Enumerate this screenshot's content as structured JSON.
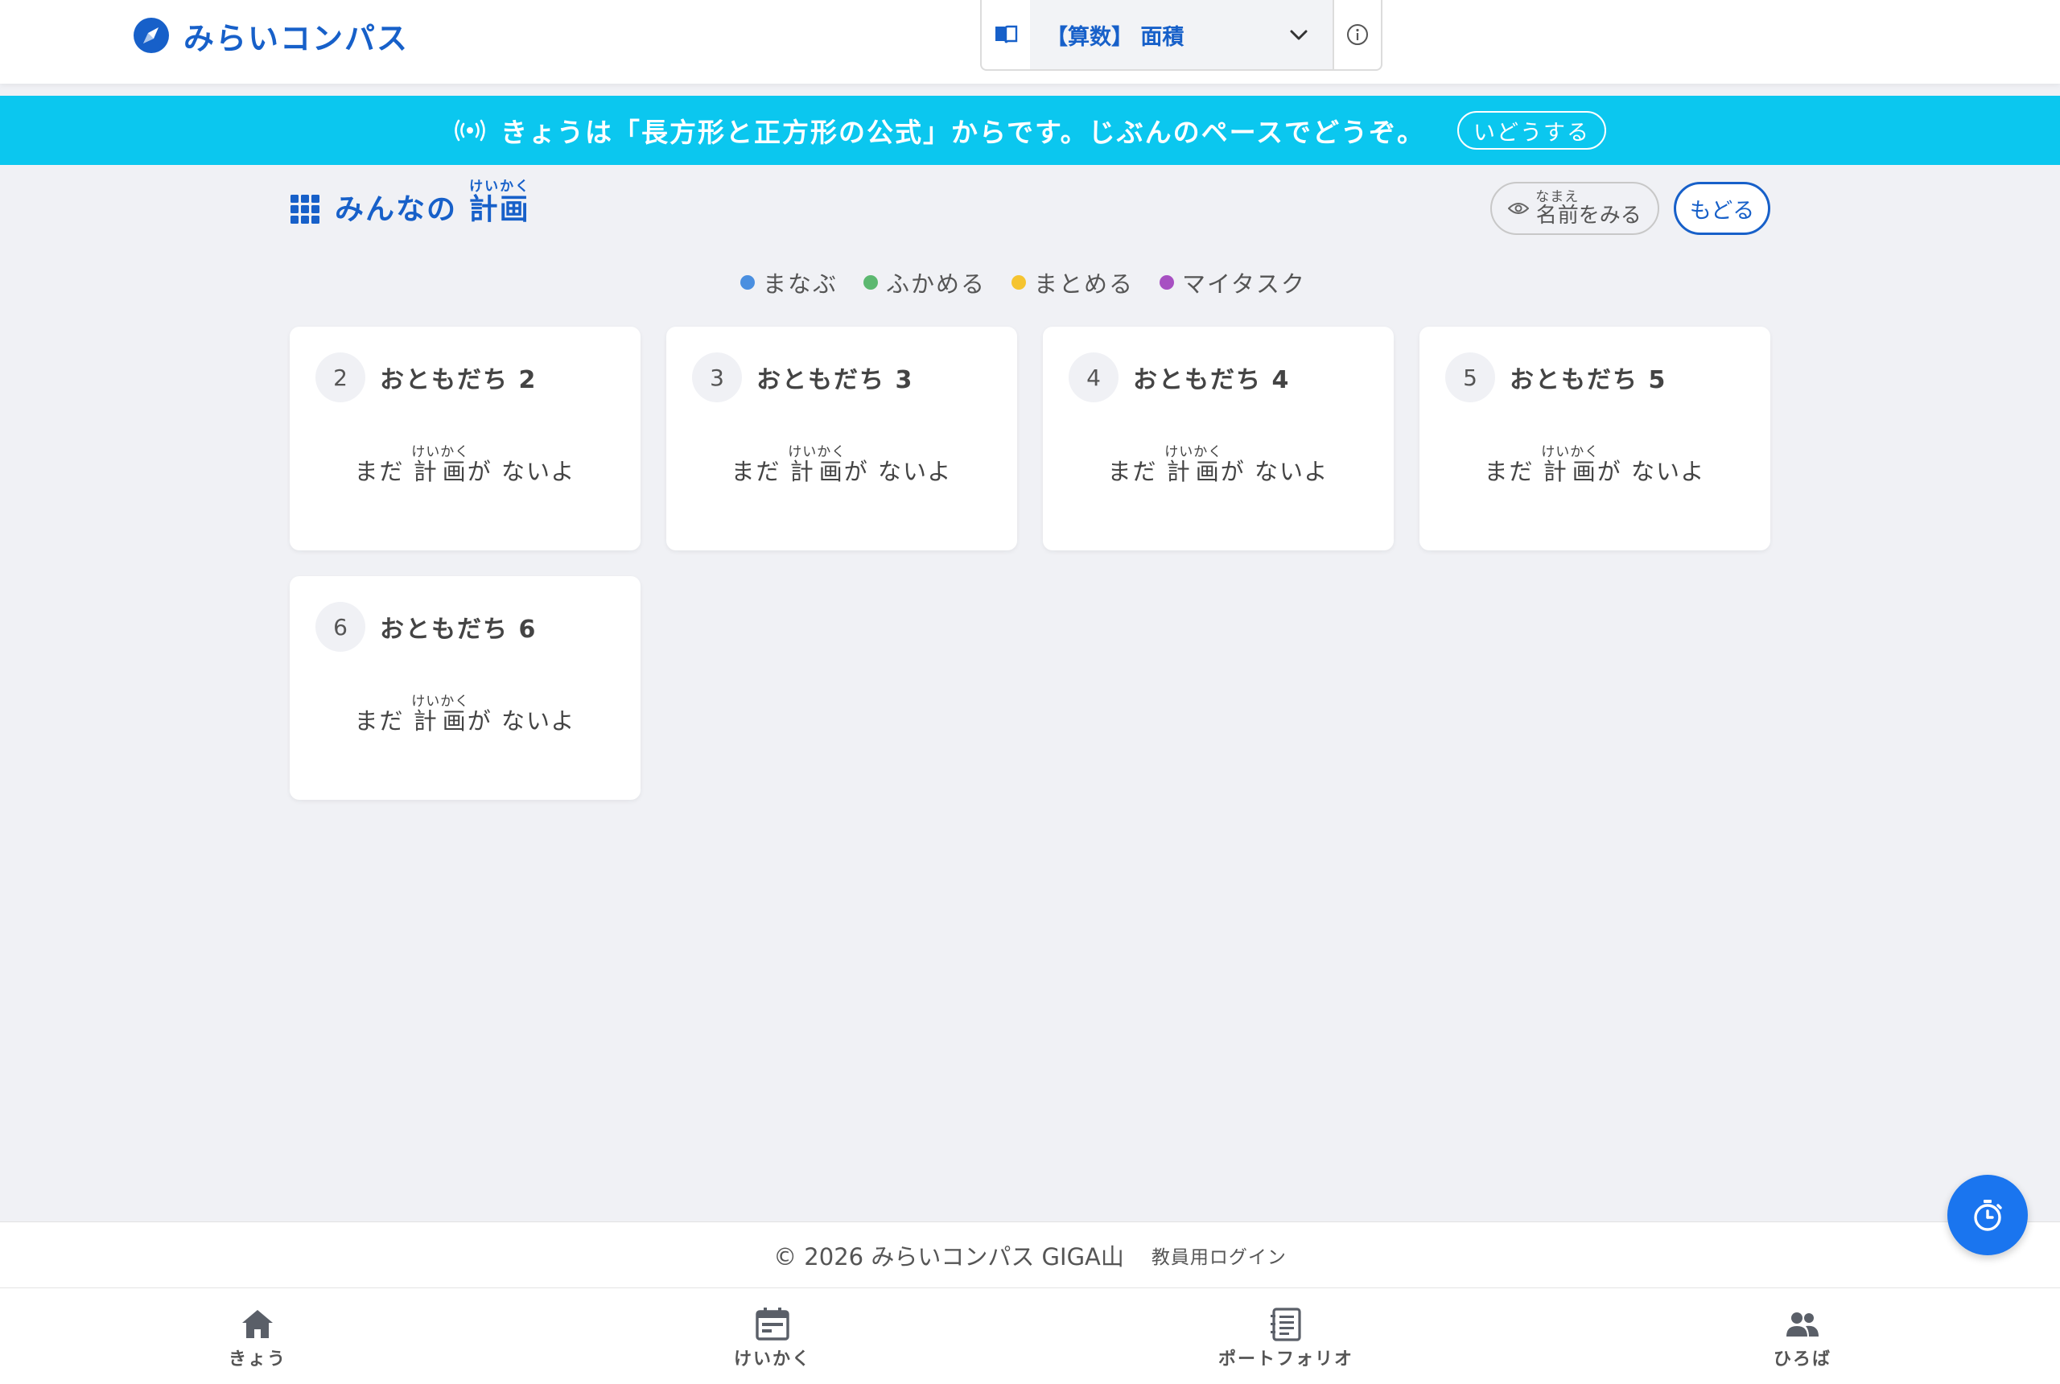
{
  "header": {
    "brand": "みらいコンパス",
    "unit": {
      "label": "【算数】 面積"
    }
  },
  "banner": {
    "message": "きょうは「長方形と正方形の公式」からです。じぶんのペースでどうぞ。",
    "action": "いどうする"
  },
  "section": {
    "title_prefix": "みんなの",
    "title_main": "計画",
    "title_ruby": "けいかく",
    "name_toggle": {
      "main": "名前",
      "ruby": "なまえ",
      "suffix": "をみる"
    },
    "back": "もどる"
  },
  "legend": [
    {
      "label": "まなぶ",
      "color": "#4a8fe0"
    },
    {
      "label": "ふかめる",
      "color": "#5cb870"
    },
    {
      "label": "まとめる",
      "color": "#f5c430"
    },
    {
      "label": "マイタスク",
      "color": "#a750c2"
    }
  ],
  "cards": [
    {
      "number": "2",
      "name": "おともだち 2"
    },
    {
      "number": "3",
      "name": "おともだち 3"
    },
    {
      "number": "4",
      "name": "おともだち 4"
    },
    {
      "number": "5",
      "name": "おともだち 5"
    },
    {
      "number": "6",
      "name": "おともだち 6"
    }
  ],
  "empty_message": {
    "prefix": "まだ",
    "word": "計画",
    "ruby": "けいかく",
    "suffix": "が ないよ"
  },
  "footer": {
    "copyright": "© 2026 みらいコンパス GIGA山",
    "teacher_login": "教員用ログイン"
  },
  "nav": [
    {
      "label": "きょう",
      "icon": "home-icon"
    },
    {
      "label": "けいかく",
      "icon": "calendar-icon"
    },
    {
      "label": "ポートフォリオ",
      "icon": "notebook-icon"
    },
    {
      "label": "ひろば",
      "icon": "people-icon"
    }
  ],
  "colors": {
    "primary": "#1760c9",
    "banner": "#0bc7ef",
    "fab": "#1a75ef",
    "background": "#f0f1f5"
  }
}
